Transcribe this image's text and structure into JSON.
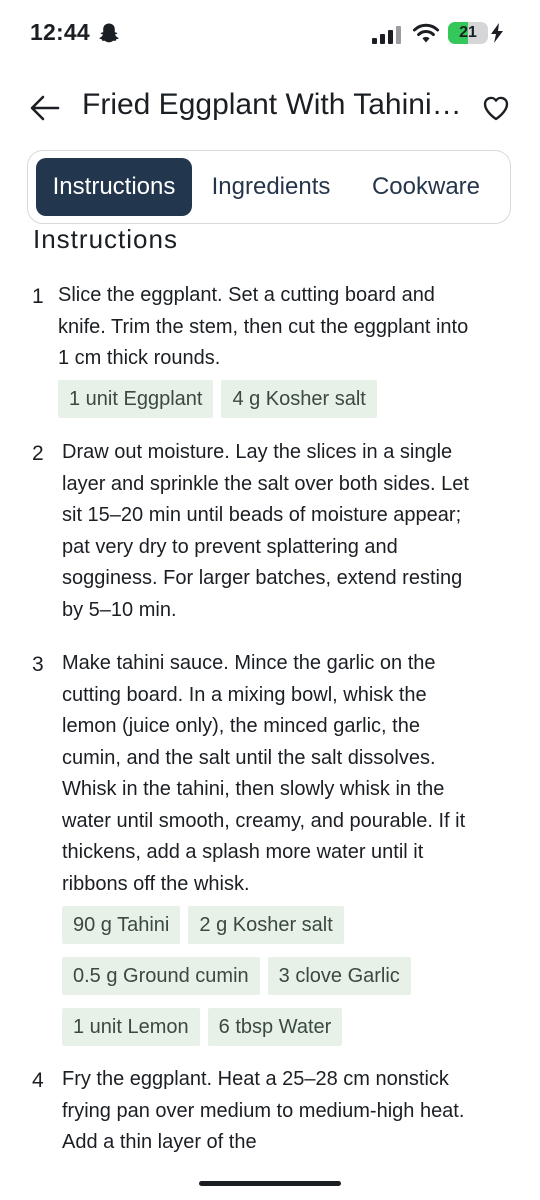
{
  "status_bar": {
    "time": "12:44",
    "battery": "21",
    "battery_level": 0.21,
    "icons": [
      "snapchat-ghost-icon",
      "signal-icon",
      "wifi-icon",
      "battery-icon",
      "charging-bolt-icon"
    ]
  },
  "header": {
    "title": "Fried Eggplant With Tahini Sauce",
    "back_icon": "arrow-left-icon",
    "favorite_icon": "heart-outline-icon"
  },
  "tabs": [
    {
      "label": "Instructions",
      "active": true
    },
    {
      "label": "Ingredients",
      "active": false
    },
    {
      "label": "Cookware",
      "active": false
    }
  ],
  "section_heading": "Instructions",
  "steps": [
    {
      "number": "1",
      "text": "Slice the eggplant. Set a cutting board and knife. Trim the stem, then cut the eggplant into 1 cm thick rounds.",
      "chips": [
        "1 unit Eggplant",
        "4 g Kosher salt"
      ]
    },
    {
      "number": "2",
      "text": "Draw out moisture. Lay the slices in a single layer and sprinkle the salt over both sides. Let sit 15–20 min until beads of moisture appear; pat very dry to prevent splattering and sogginess. For larger batches, extend resting by 5–10 min.",
      "chips": []
    },
    {
      "number": "3",
      "text": "Make tahini sauce. Mince the garlic on the cutting board. In a mixing bowl, whisk the lemon (juice only), the minced garlic, the cumin, and the salt until the salt dissolves. Whisk in the tahini, then slowly whisk in the water until smooth, creamy, and pourable. If it thickens, add a splash more water until it ribbons off the whisk.",
      "chips": [
        "90 g Tahini",
        "2 g Kosher salt",
        "0.5 g Ground cumin",
        "3 clove Garlic",
        "1 unit Lemon",
        "6 tbsp Water"
      ]
    },
    {
      "number": "4",
      "text": "Fry the eggplant. Heat a 25–28 cm nonstick frying pan over medium to medium-high heat. Add a thin layer of the",
      "chips": []
    }
  ],
  "colors": {
    "active_tab_bg": "#22364d",
    "chip_bg": "#e8f1e8",
    "battery_green": "#34c759"
  }
}
